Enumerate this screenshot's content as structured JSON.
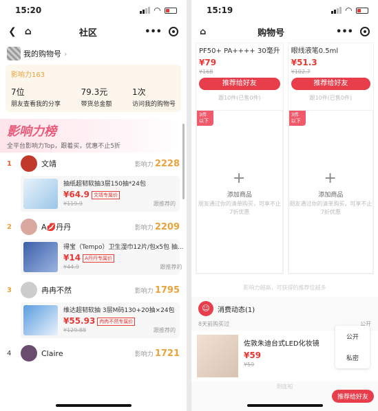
{
  "left": {
    "time": "15:20",
    "title": "社区",
    "my_shop": "我的购物号",
    "influence_level": "影响力163",
    "stats": [
      {
        "n": "7位",
        "label": "朋友查看我的分享"
      },
      {
        "n": "79.3元",
        "label": "带货总金额"
      },
      {
        "n": "1次",
        "label": "访问我的购物号"
      }
    ],
    "rank_title": "影响力榜",
    "rank_sub": "全平台影响力Top，跟着买，优惠不止5折",
    "score_label": "影响力",
    "users": [
      {
        "rank": "1",
        "name": "文靖",
        "score": "2228",
        "product": "抽纸超韧软抽3层150抽*24包",
        "price": "¥64.9",
        "tag": "文靖专属价",
        "old": "¥119.9",
        "buyers": "跟推荐的"
      },
      {
        "rank": "2",
        "name": "A💋丹丹",
        "score": "2209",
        "product": "得宝（Tempo）卫生湿巾12片/包x5包 抽...",
        "price": "¥14",
        "tag": "A丹丹专属价",
        "old": "¥44.9",
        "buyers": "跟推荐的"
      },
      {
        "rank": "3",
        "name": "冉冉不然",
        "score": "1795",
        "product": "维达超韧软抽 3层M码130+20抽×24包",
        "price": "¥55.93",
        "tag": "冉冉不然专属价",
        "old": "¥129.88",
        "buyers": "跟推荐的"
      },
      {
        "rank": "4",
        "name": "Claire",
        "score": "1721"
      }
    ]
  },
  "right": {
    "time": "15:19",
    "title": "购物号",
    "products": [
      {
        "name": "PF50+ PA++++ 30毫升",
        "price": "¥79",
        "old": "¥168",
        "btn": "推荐给好友",
        "count": "跟10件(已售0件)"
      },
      {
        "name": "眼线液笔0.5ml",
        "price": "¥51.3",
        "old": "¥102.7",
        "btn": "推荐给好友",
        "count": "跟10件(已售0件)"
      }
    ],
    "slot_corner": "3件以下",
    "add_label": "添加商品",
    "add_hint": "朋友通过你的清单购买，可享不止7折优惠",
    "note": "影响力越高，可获得的推荐位越多",
    "consume_title": "消费动态(1)",
    "consume_sub": "8天前购买过",
    "visibility": "公开",
    "item": {
      "name": "佐敦朱迪台式LED化妆镜",
      "price": "¥59",
      "old": "¥59",
      "btn": "推荐给好友"
    },
    "menu": [
      "公开",
      "私密"
    ],
    "end": "到底啦"
  }
}
